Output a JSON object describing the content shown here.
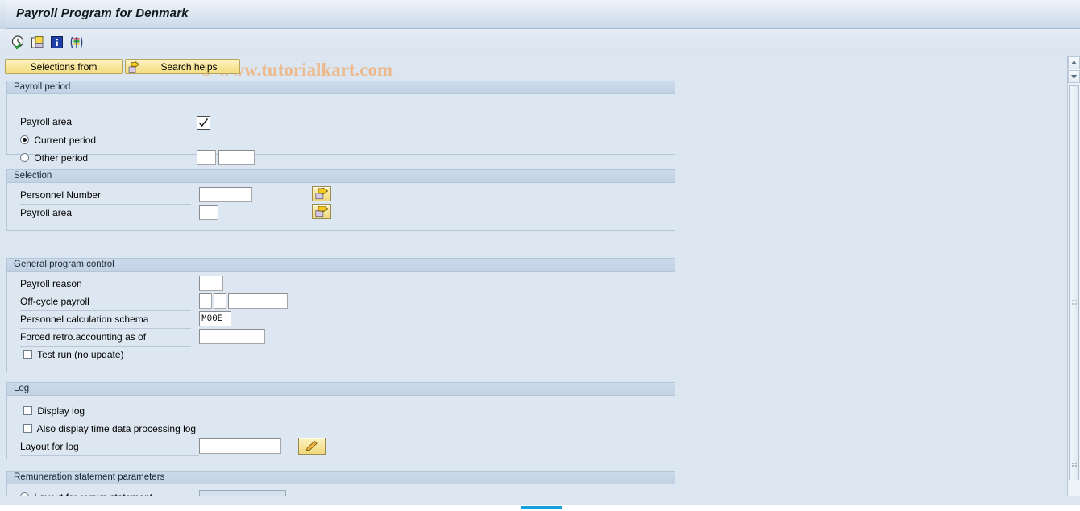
{
  "window": {
    "title": "Payroll Program for Denmark"
  },
  "watermark": {
    "text": "© www.tutorialkart.com"
  },
  "toolbar": {
    "icons": [
      {
        "name": "execute-clock-icon",
        "label": "Execute"
      },
      {
        "name": "get-variant-icon",
        "label": "Get Variant"
      },
      {
        "name": "information-icon",
        "label": "Information"
      },
      {
        "name": "color-legend-icon",
        "label": "Legend"
      }
    ]
  },
  "buttons": {
    "selections_from": "Selections from",
    "search_helps": "Search helps"
  },
  "sections": {
    "payroll_period": {
      "header": "Payroll period",
      "payroll_area_label": "Payroll area",
      "payroll_area_value": "",
      "current_period_label": "Current period",
      "current_period_selected": true,
      "other_period_label": "Other period",
      "other_period_selected": false,
      "other_period_value_1": "",
      "other_period_value_2": ""
    },
    "selection": {
      "header": "Selection",
      "personnel_number_label": "Personnel Number",
      "personnel_number_value": "",
      "payroll_area_label": "Payroll area",
      "payroll_area_value": "",
      "multi_select_1": "multi-select-arrow-icon",
      "multi_select_2": "multi-select-arrow-icon"
    },
    "general_program_control": {
      "header": "General program control",
      "payroll_reason_label": "Payroll reason",
      "payroll_reason_value": "",
      "off_cycle_label": "Off-cycle payroll",
      "off_cycle_value_1": "",
      "off_cycle_value_2": "",
      "off_cycle_value_3": "",
      "schema_label": "Personnel calculation schema",
      "schema_value": "M00E",
      "forced_retro_label": "Forced retro.accounting as of",
      "forced_retro_value": "",
      "test_run_label": "Test run (no update)",
      "test_run_checked": false
    },
    "log": {
      "header": "Log",
      "display_log_label": "Display log",
      "display_log_checked": false,
      "time_data_log_label": "Also display time data processing log",
      "time_data_log_checked": false,
      "layout_for_log_label": "Layout for log",
      "layout_for_log_value": "",
      "layout_edit_icon": "pencil-edit-icon"
    },
    "remuneration": {
      "header": "Remuneration statement parameters",
      "layout_label": "Layout for remun.statement",
      "layout_selected": false,
      "layout_value": ""
    }
  },
  "scrollbars": {
    "vertical_up": "▲",
    "vertical_down": "▼"
  },
  "colors": {
    "accent_yellow": "#f6e497",
    "group_header": "#c6d5e7",
    "canvas": "#dce6f0",
    "hscroll_thumb": "#14a0dc",
    "watermark": "#f0b27a"
  }
}
